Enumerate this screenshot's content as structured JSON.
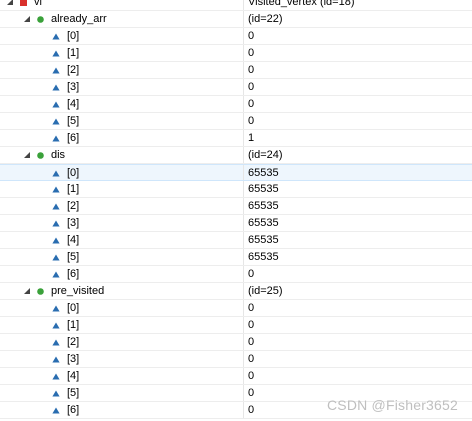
{
  "root": {
    "name": "vi",
    "value": "Visited_vertex  (id=18)"
  },
  "groups": [
    {
      "name": "already_arr",
      "value": "(id=22)",
      "items": [
        {
          "index": "[0]",
          "value": "0"
        },
        {
          "index": "[1]",
          "value": "0"
        },
        {
          "index": "[2]",
          "value": "0"
        },
        {
          "index": "[3]",
          "value": "0"
        },
        {
          "index": "[4]",
          "value": "0"
        },
        {
          "index": "[5]",
          "value": "0"
        },
        {
          "index": "[6]",
          "value": "1"
        }
      ]
    },
    {
      "name": "dis",
      "value": "(id=24)",
      "items": [
        {
          "index": "[0]",
          "value": "65535"
        },
        {
          "index": "[1]",
          "value": "65535"
        },
        {
          "index": "[2]",
          "value": "65535"
        },
        {
          "index": "[3]",
          "value": "65535"
        },
        {
          "index": "[4]",
          "value": "65535"
        },
        {
          "index": "[5]",
          "value": "65535"
        },
        {
          "index": "[6]",
          "value": "0"
        }
      ]
    },
    {
      "name": "pre_visited",
      "value": "(id=25)",
      "items": [
        {
          "index": "[0]",
          "value": "0"
        },
        {
          "index": "[1]",
          "value": "0"
        },
        {
          "index": "[2]",
          "value": "0"
        },
        {
          "index": "[3]",
          "value": "0"
        },
        {
          "index": "[4]",
          "value": "0"
        },
        {
          "index": "[5]",
          "value": "0"
        },
        {
          "index": "[6]",
          "value": "0"
        }
      ]
    }
  ],
  "watermark": "CSDN @Fisher3652",
  "icons": {
    "expander": "expanded-triangle-icon",
    "root": "red-square-field-icon",
    "group": "green-circle-field-icon",
    "item": "blue-triangle-array-element-icon"
  },
  "colors": {
    "root_icon": "#d9302c",
    "group_icon": "#3aa13a",
    "item_icon": "#2a6db0",
    "selected_row": "#eef6fd"
  }
}
